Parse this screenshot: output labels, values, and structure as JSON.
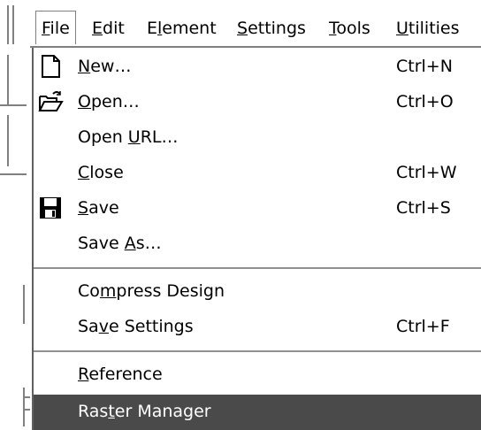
{
  "menubar": {
    "items": [
      {
        "pre": "",
        "key": "F",
        "post": "ile"
      },
      {
        "pre": "",
        "key": "E",
        "post": "dit"
      },
      {
        "pre": "E",
        "key": "l",
        "post": "ement"
      },
      {
        "pre": "",
        "key": "S",
        "post": "ettings"
      },
      {
        "pre": "",
        "key": "T",
        "post": "ools"
      },
      {
        "pre": "",
        "key": "U",
        "post": "tilities"
      }
    ]
  },
  "file_menu": {
    "items": [
      {
        "pre": "",
        "key": "N",
        "post": "ew…",
        "shortcut": "Ctrl+N",
        "icon": "new-document-icon"
      },
      {
        "pre": "",
        "key": "O",
        "post": "pen…",
        "shortcut": "Ctrl+O",
        "icon": "open-folder-icon"
      },
      {
        "pre": "Open ",
        "key": "U",
        "post": "RL…",
        "shortcut": ""
      },
      {
        "pre": "",
        "key": "C",
        "post": "lose",
        "shortcut": "Ctrl+W"
      },
      {
        "pre": "",
        "key": "S",
        "post": "ave",
        "shortcut": "Ctrl+S",
        "icon": "floppy-disk-icon"
      },
      {
        "pre": "Save ",
        "key": "A",
        "post": "s…",
        "shortcut": ""
      },
      {
        "pre": "Co",
        "key": "m",
        "post": "press Design",
        "shortcut": ""
      },
      {
        "pre": "Sa",
        "key": "v",
        "post": "e Settings",
        "shortcut": "Ctrl+F"
      },
      {
        "pre": "",
        "key": "R",
        "post": "eference",
        "shortcut": ""
      },
      {
        "pre": "Ras",
        "key": "t",
        "post": "er Manager",
        "shortcut": ""
      }
    ]
  },
  "colors": {
    "highlight": "#4a4a4a",
    "separator": "#909090"
  }
}
